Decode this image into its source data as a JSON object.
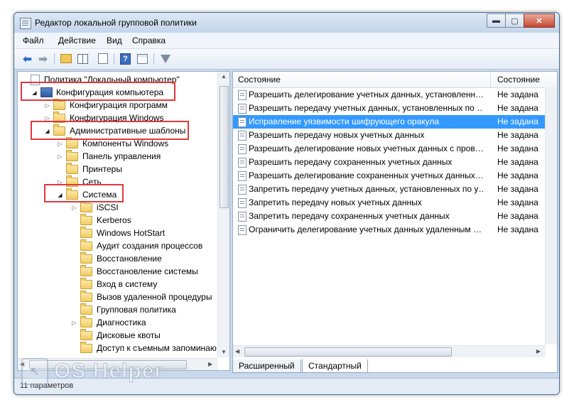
{
  "window": {
    "title": "Редактор локальной групповой политики"
  },
  "menu": [
    "Файл",
    "Действие",
    "Вид",
    "Справка"
  ],
  "tree": [
    {
      "label": "Политика \"Локальный компьютер\"",
      "icon": "doc",
      "twisty": "",
      "level": 0
    },
    {
      "label": "Конфигурация компьютера",
      "icon": "computer",
      "twisty": "expanded",
      "level": 1
    },
    {
      "label": "Конфигурация программ",
      "icon": "folder",
      "twisty": "collapsed",
      "level": 2
    },
    {
      "label": "Конфигурация Windows",
      "icon": "folder",
      "twisty": "collapsed",
      "level": 2
    },
    {
      "label": "Административные шаблоны",
      "icon": "folder",
      "twisty": "expanded",
      "level": 2
    },
    {
      "label": "Компоненты Windows",
      "icon": "folder",
      "twisty": "collapsed",
      "level": 3
    },
    {
      "label": "Панель управления",
      "icon": "folder",
      "twisty": "collapsed",
      "level": 3
    },
    {
      "label": "Принтеры",
      "icon": "folder",
      "twisty": "",
      "level": 3
    },
    {
      "label": "Сеть",
      "icon": "folder",
      "twisty": "collapsed",
      "level": 3
    },
    {
      "label": "Система",
      "icon": "folder",
      "twisty": "expanded",
      "level": 3
    },
    {
      "label": "iSCSI",
      "icon": "folder",
      "twisty": "collapsed",
      "level": 4
    },
    {
      "label": "Kerberos",
      "icon": "folder",
      "twisty": "",
      "level": 4
    },
    {
      "label": "Windows HotStart",
      "icon": "folder",
      "twisty": "",
      "level": 4
    },
    {
      "label": "Аудит создания процессов",
      "icon": "folder",
      "twisty": "",
      "level": 4
    },
    {
      "label": "Восстановление",
      "icon": "folder",
      "twisty": "",
      "level": 4
    },
    {
      "label": "Восстановление системы",
      "icon": "folder",
      "twisty": "",
      "level": 4
    },
    {
      "label": "Вход в систему",
      "icon": "folder",
      "twisty": "",
      "level": 4
    },
    {
      "label": "Вызов удаленной процедуры",
      "icon": "folder",
      "twisty": "",
      "level": 4
    },
    {
      "label": "Групповая политика",
      "icon": "folder",
      "twisty": "",
      "level": 4
    },
    {
      "label": "Диагностика",
      "icon": "folder",
      "twisty": "collapsed",
      "level": 4
    },
    {
      "label": "Дисковые квоты",
      "icon": "folder",
      "twisty": "",
      "level": 4
    },
    {
      "label": "Доступ к съемным запоминаю",
      "icon": "folder",
      "twisty": "",
      "level": 4
    }
  ],
  "list": {
    "headers": {
      "name": "Состояние",
      "state": "Состояние"
    },
    "rows": [
      {
        "name": "Разрешить делегирование учетных данных, установленн…",
        "state": "Не задана",
        "selected": false
      },
      {
        "name": "Разрешить передачу учетных данных, установленных по …",
        "state": "Не задана",
        "selected": false
      },
      {
        "name": "Исправление уязвимости шифрующего оракула",
        "state": "Не задана",
        "selected": true
      },
      {
        "name": "Разрешить передачу новых учетных данных",
        "state": "Не задана",
        "selected": false
      },
      {
        "name": "Разрешить делегирование новых учетных данных с пров…",
        "state": "Не задана",
        "selected": false
      },
      {
        "name": "Разрешить передачу сохраненных учетных данных",
        "state": "Не задана",
        "selected": false
      },
      {
        "name": "Разрешить делегирование сохраненных учетных данных…",
        "state": "Не задана",
        "selected": false
      },
      {
        "name": "Запретить передачу учетных данных, установленных по у…",
        "state": "Не задана",
        "selected": false
      },
      {
        "name": "Запретить передачу новых учетных данных",
        "state": "Не задана",
        "selected": false
      },
      {
        "name": "Запретить передачу сохраненных учетных данных",
        "state": "Не задана",
        "selected": false
      },
      {
        "name": "Ограничить делегирование учетных данных удаленным …",
        "state": "Не задана",
        "selected": false
      }
    ]
  },
  "tabs": [
    "Расширенный",
    "Стандартный"
  ],
  "status": "11 параметров",
  "watermark": "OS Helper",
  "colors": {
    "highlight": "#e2383c",
    "selection": "#3399ff"
  }
}
